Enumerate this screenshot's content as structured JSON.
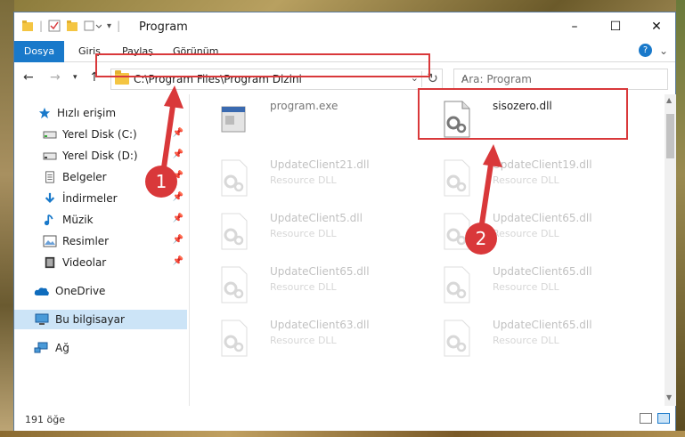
{
  "window": {
    "title": "Program",
    "controls": {
      "minimize": "–",
      "maximize": "☐",
      "close": "✕"
    }
  },
  "ribbon": {
    "tabs": [
      "Dosya",
      "Giriş",
      "Paylaş",
      "Görünüm"
    ],
    "help": "?"
  },
  "navbar": {
    "address": "C:\\Program Files\\Program Dizini",
    "search_placeholder": "Ara: Program"
  },
  "sidebar": {
    "items": [
      {
        "label": "Hızlı erişim",
        "icon": "star-icon"
      },
      {
        "label": "Yerel Disk (C:)",
        "icon": "drive-icon"
      },
      {
        "label": "Yerel Disk (D:)",
        "icon": "drive-icon"
      },
      {
        "label": "Belgeler",
        "icon": "document-icon"
      },
      {
        "label": "İndirmeler",
        "icon": "download-icon"
      },
      {
        "label": "Müzik",
        "icon": "music-icon"
      },
      {
        "label": "Resimler",
        "icon": "pictures-icon"
      },
      {
        "label": "Videolar",
        "icon": "video-icon"
      },
      {
        "label": "OneDrive",
        "icon": "cloud-icon"
      },
      {
        "label": "Bu bilgisayar",
        "icon": "computer-icon"
      },
      {
        "label": "Ağ",
        "icon": "network-icon"
      }
    ]
  },
  "files": [
    {
      "name": "program.exe",
      "type": ""
    },
    {
      "name": "sisozero.dll",
      "type": ""
    },
    {
      "name": "UpdateClient21.dll",
      "type": "Resource DLL"
    },
    {
      "name": "UpdateClient19.dll",
      "type": "Resource DLL"
    },
    {
      "name": "UpdateClient5.dll",
      "type": "Resource DLL"
    },
    {
      "name": "UpdateClient65.dll",
      "type": "Resource DLL"
    },
    {
      "name": "UpdateClient65.dll",
      "type": "Resource DLL"
    },
    {
      "name": "UpdateClient65.dll",
      "type": "Resource DLL"
    },
    {
      "name": "UpdateClient63.dll",
      "type": "Resource DLL"
    },
    {
      "name": "UpdateClient65.dll",
      "type": "Resource DLL"
    }
  ],
  "status": {
    "count": "191 öğe"
  },
  "annotations": {
    "step1": "1",
    "step2": "2",
    "color": "#d9383a"
  }
}
